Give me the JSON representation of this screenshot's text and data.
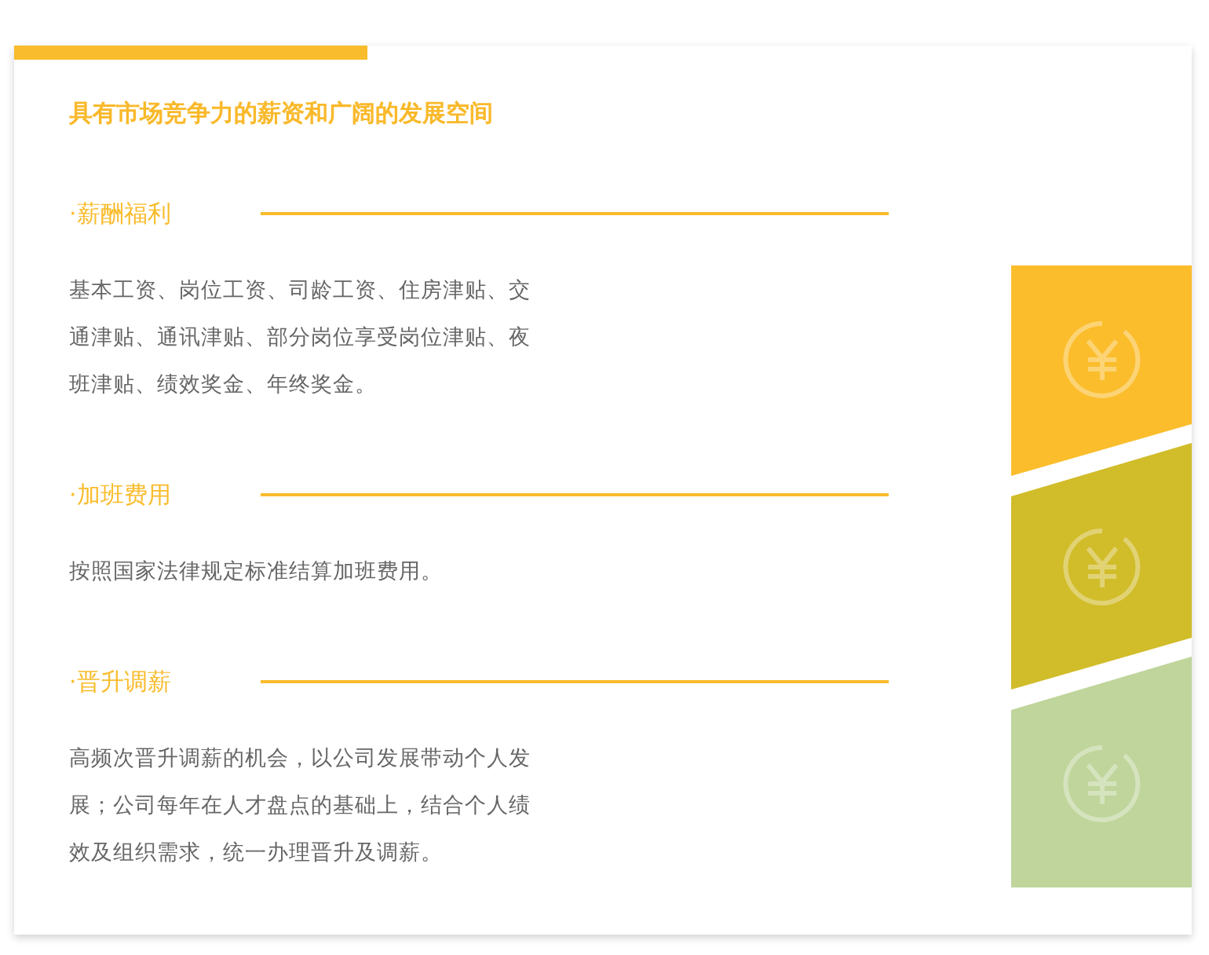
{
  "title": "具有市场竞争力的薪资和广阔的发展空间",
  "sections": [
    {
      "heading": "·薪酬福利",
      "lines": [
        "基本工资、岗位工资、司龄工资、住房津贴、交",
        "通津贴、通讯津贴、部分岗位享受岗位津贴、夜",
        "班津贴、绩效奖金、年终奖金。"
      ]
    },
    {
      "heading": "·加班费用",
      "lines": [
        "按照国家法律规定标准结算加班费用。"
      ]
    },
    {
      "heading": "·晋升调薪",
      "lines": [
        "高频次晋升调薪的机会，以公司发展带动个人发",
        "展；公司每年在人才盘点的基础上，结合个人绩",
        "效及组织需求，统一办理晋升及调薪。"
      ]
    }
  ],
  "emblems": [
    {
      "color": "#fbbd2c"
    },
    {
      "color": "#d1bc2a"
    },
    {
      "color": "#bfd59b"
    }
  ]
}
